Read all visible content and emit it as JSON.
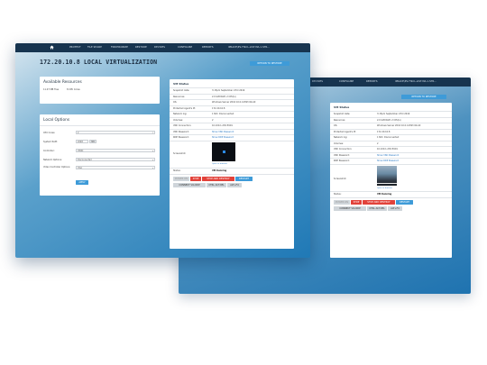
{
  "front": {
    "nav": {
      "items": [
        "PROTECT",
        "FILE SHARE",
        "FINCHRONIZE",
        "RESTORE",
        "DEVICES",
        "CONFIGURE",
        "REPORTS"
      ],
      "user": "IPRACE\\PS-FISCL-LIST.MA.1.STR..."
    },
    "title": "172.20.10.8 LOCAL VIRTUALIZATION",
    "return_button": "RETURN TO RESTORE",
    "resources": {
      "heading": "Available Resources",
      "ram": "11.07 MB Free",
      "cpu": "8 CPU Cores"
    },
    "options": {
      "heading": "Local Options",
      "rows": [
        {
          "label": "CPU Cores:",
          "value": "2"
        },
        {
          "label": "System RAM:",
          "value": "2048",
          "unit": "MB"
        },
        {
          "label": "Controller:",
          "value": "VIRIO"
        },
        {
          "label": "Network Options:",
          "value": "Disconnected"
        },
        {
          "label": "Video Controller Options:",
          "value": "VGA"
        }
      ],
      "apply": "APPLY"
    },
    "status": {
      "heading": "VM Status",
      "rows": [
        {
          "label": "Snapshot date:",
          "value": "3:15pm September 23rd 2016"
        },
        {
          "label": "Resources:",
          "value": "2.0 GiB RAM, 2 CPU(s)"
        },
        {
          "label": "OS:",
          "value": "Windows Server 2016 10.0.14393 64-bit"
        },
        {
          "label": "Protected Agent's IP:",
          "value": "172.20.10.8"
        },
        {
          "label": "Network log:",
          "value": "1 NIC: Disconnected"
        },
        {
          "label": "Volumes:",
          "value": "2"
        },
        {
          "label": "VNC Connection:",
          "value": "10.100.1.230:5901"
        },
        {
          "label": "VNC Password:",
          "value": "Show VNC Password"
        },
        {
          "label": "RDP Password:",
          "value": "Show RDP Password"
        },
        {
          "label": "Screenshot:",
          "value": ""
        },
        {
          "label": "Status:",
          "value": "VM Running"
        }
      ],
      "screenshot_link": "Open in browser",
      "buttons": [
        "POWER ON",
        "STOP",
        "STOP AND DESTROY",
        "RESTART"
      ],
      "buttons2": [
        "CONNECT VIA RDP",
        "CTRL ALT DEL",
        "ALT+F4"
      ]
    }
  },
  "back": {
    "nav": {
      "items": [
        "DEVICES",
        "CONFIGURE",
        "REPORTS"
      ],
      "user": "IPRACE\\PS-FISCL-LIST.MA.1.STR..."
    },
    "return_button": "RETURN TO RESTORE",
    "status": {
      "heading": "VM Status",
      "rows": [
        {
          "label": "Snapshot date:",
          "value": "3:15pm September 23rd 2016"
        },
        {
          "label": "Resources:",
          "value": "2.0 GiB RAM, 2 CPU(s)"
        },
        {
          "label": "OS:",
          "value": "Windows Server 2016 10.0.14393 64-bit"
        },
        {
          "label": "Protected Agent's IP:",
          "value": "172.20.10.8"
        },
        {
          "label": "Network log:",
          "value": "1 NIC: Disconnected"
        },
        {
          "label": "Volumes:",
          "value": "2"
        },
        {
          "label": "VNC Connection:",
          "value": "10.100.1.230:5901"
        },
        {
          "label": "VNC Password:",
          "value": "Show VNC Password"
        },
        {
          "label": "RDP Password:",
          "value": "Show RDP Password"
        },
        {
          "label": "Screenshot:",
          "value": ""
        },
        {
          "label": "Status:",
          "value": "VM Running"
        }
      ],
      "screenshot_link": "Open in browser",
      "buttons": [
        "POWER ON",
        "STOP",
        "STOP AND DESTROY",
        "RESTART"
      ],
      "buttons2": [
        "CONNECT VIA RDP",
        "CTRL ALT DEL",
        "ALT+F4"
      ]
    }
  },
  "colors": {
    "nav": "#17344f",
    "accent": "#3e9bd8",
    "danger": "#e2423a",
    "background": "#2079b6"
  },
  "icons": {
    "home": "home-icon",
    "user": "user-icon",
    "dropdown": "chevron-down-icon",
    "windows": "windows-logo-icon"
  }
}
